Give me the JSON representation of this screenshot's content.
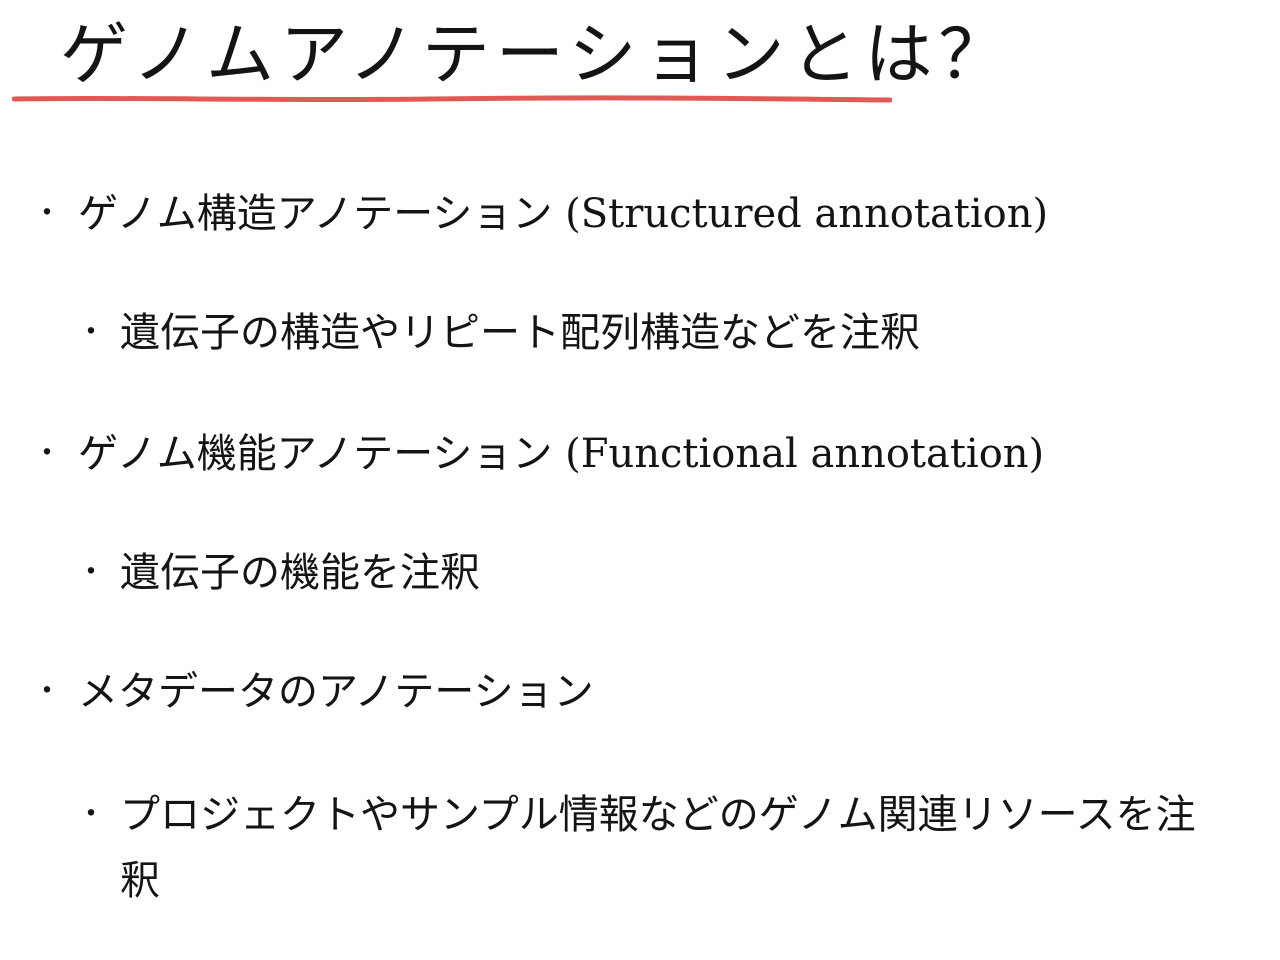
{
  "slide": {
    "title": "ゲノムアノテーションとは？",
    "accent_color": "#e05a55",
    "bullets": [
      {
        "level": 1,
        "text": "ゲノム構造アノテーション (Structured annotation)"
      },
      {
        "level": 2,
        "text": "遺伝子の構造やリピート配列構造などを注釈"
      },
      {
        "level": 1,
        "text": "ゲノム機能アノテーション (Functional annotation)"
      },
      {
        "level": 2,
        "text": "遺伝子の機能を注釈"
      },
      {
        "level": 1,
        "text": "メタデータのアノテーション"
      },
      {
        "level": 2,
        "text": "プロジェクトやサンプル情報などのゲノム関連リソースを注釈"
      }
    ],
    "bullet_glyph": "・"
  }
}
